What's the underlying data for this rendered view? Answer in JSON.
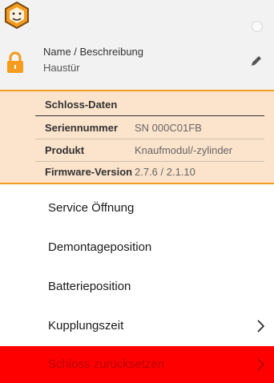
{
  "header": {
    "name_label": "Name / Beschreibung",
    "name_value": "Haustür",
    "icons": [
      "lion-logo-icon",
      "radio-icon",
      "lock-icon",
      "pencil-icon"
    ]
  },
  "schloss_daten": {
    "title": "Schloss-Daten",
    "rows": [
      {
        "key": "Seriennummer",
        "value": "SN 000C01FB"
      },
      {
        "key": "Produkt",
        "value": "Knaufmodul/-zylinder"
      },
      {
        "key": "Firmware-Version",
        "value": "2.7.6 / 2.1.10"
      }
    ]
  },
  "menu": {
    "items": [
      {
        "label": "Service Öffnung"
      },
      {
        "label": "Demontageposition"
      },
      {
        "label": "Batterieposition"
      },
      {
        "label": "Kupplungszeit"
      },
      {
        "label": "Schloss zurücksetzen"
      }
    ]
  },
  "colors": {
    "accent": "#f39c1e",
    "info_bg": "#fbe3cc",
    "danger": "#ff0000"
  }
}
